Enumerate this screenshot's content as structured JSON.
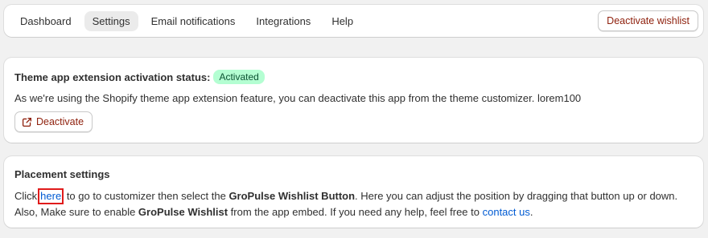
{
  "nav": {
    "tabs": [
      {
        "label": "Dashboard",
        "active": false
      },
      {
        "label": "Settings",
        "active": true
      },
      {
        "label": "Email notifications",
        "active": false
      },
      {
        "label": "Integrations",
        "active": false
      },
      {
        "label": "Help",
        "active": false
      }
    ],
    "deactivate_wishlist_label": "Deactivate wishlist"
  },
  "extension_card": {
    "heading": "Theme app extension activation status:",
    "status_badge": "Activated",
    "description": "As we're using the Shopify theme app extension feature, you can deactivate this app from the theme customizer. lorem100",
    "deactivate_label": "Deactivate",
    "deactivate_icon": "external-link-icon"
  },
  "placement_card": {
    "heading": "Placement settings",
    "text_click": "Click",
    "here_link": "here",
    "text_after_here": " to go to customizer then select the ",
    "bold_button": "GroPulse Wishlist Button",
    "text_mid": ". Here you can adjust the position by dragging that button up or down. Also, Make sure to enable ",
    "bold_wishlist": "GroPulse Wishlist",
    "text_before_contact": " from the app embed. If you need any help, feel free to ",
    "contact_link": "contact us",
    "text_end": "."
  },
  "colors": {
    "accent_link": "#005bd3",
    "critical_text": "#8e1f0b",
    "success_badge_bg": "#b4fed2",
    "highlight_box": "#e01b1b"
  }
}
